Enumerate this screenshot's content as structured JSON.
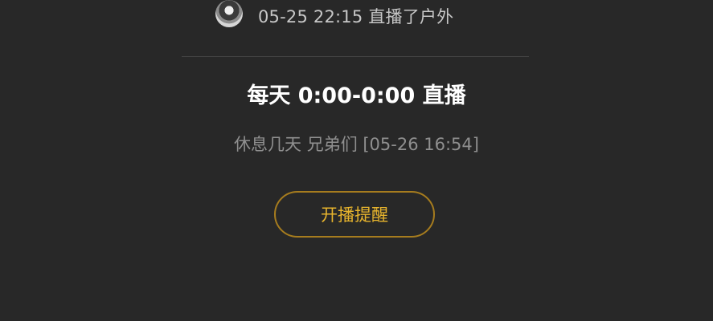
{
  "last_live": {
    "text": "05-25 22:15 直播了户外"
  },
  "schedule": {
    "title": "每天 0:00-0:00 直播",
    "notice": "休息几天 兄弟们 [05-26 16:54]"
  },
  "remind_button": {
    "label": "开播提醒"
  },
  "colors": {
    "background": "#282828",
    "accent": "#e7b42d",
    "button_border": "#a67c1e"
  }
}
